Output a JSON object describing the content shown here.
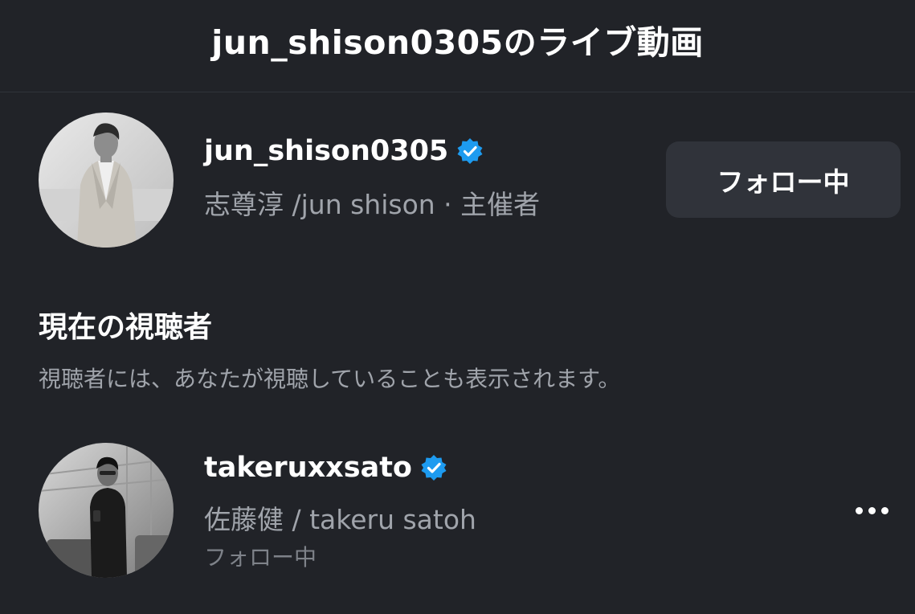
{
  "header": {
    "title": "jun_shison0305のライブ動画"
  },
  "host": {
    "username": "jun_shison0305",
    "verified_icon": "verified-badge-icon",
    "subtitle": "志尊淳 /jun shison · 主催者",
    "follow_label": "フォロー中"
  },
  "viewers_section": {
    "title": "現在の視聴者",
    "description": "視聴者には、あなたが視聴していることも表示されます。"
  },
  "viewers": [
    {
      "username": "takeruxxsato",
      "verified_icon": "verified-badge-icon",
      "full_name": "佐藤健 / takeru satoh",
      "status": "フォロー中",
      "more_icon": "more-options-icon"
    }
  ],
  "colors": {
    "background": "#212328",
    "button_bg": "#30333a",
    "secondary_text": "#a0a4ab",
    "verified_blue": "#1d9bf0"
  }
}
